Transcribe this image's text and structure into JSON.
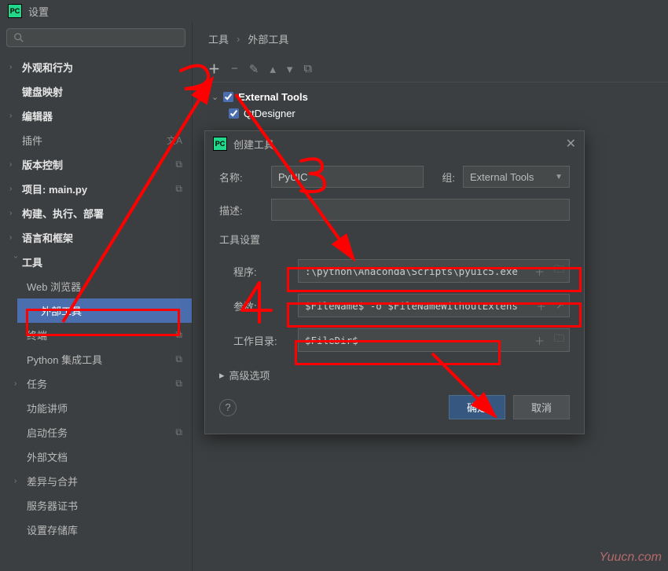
{
  "titlebar": {
    "title": "设置"
  },
  "sidebar": {
    "items": [
      {
        "label": "外观和行为",
        "bold": true,
        "arrow": true
      },
      {
        "label": "键盘映射",
        "bold": true,
        "arrow": false
      },
      {
        "label": "编辑器",
        "bold": true,
        "arrow": true
      },
      {
        "label": "插件",
        "bold": false,
        "arrow": false,
        "icon": "translate"
      },
      {
        "label": "版本控制",
        "bold": true,
        "arrow": true,
        "icon": "copy"
      },
      {
        "label": "项目: main.py",
        "bold": true,
        "arrow": true,
        "icon": "copy"
      },
      {
        "label": "构建、执行、部署",
        "bold": true,
        "arrow": true
      },
      {
        "label": "语言和框架",
        "bold": true,
        "arrow": true
      },
      {
        "label": "工具",
        "bold": true,
        "arrow": true,
        "expanded": true
      }
    ],
    "tools_children": [
      {
        "label": "Web 浏览器"
      },
      {
        "label": "外部工具",
        "selected": true
      },
      {
        "label": "终端",
        "icon": "copy"
      },
      {
        "label": "Python 集成工具",
        "icon": "copy"
      },
      {
        "label": "任务",
        "arrow": true,
        "icon": "copy"
      },
      {
        "label": "功能讲师"
      },
      {
        "label": "启动任务",
        "icon": "copy"
      },
      {
        "label": "外部文档"
      },
      {
        "label": "差异与合并",
        "arrow": true
      },
      {
        "label": "服务器证书"
      },
      {
        "label": "设置存储库"
      }
    ]
  },
  "breadcrumb": {
    "parent": "工具",
    "current": "外部工具"
  },
  "tool_list": {
    "group": "External Tools",
    "child": "QtDesigner"
  },
  "dialog": {
    "title": "创建工具",
    "labels": {
      "name": "名称:",
      "group": "组:",
      "desc": "描述:",
      "section": "工具设置",
      "program": "程序:",
      "args": "参数:",
      "workdir": "工作目录:",
      "advanced": "高级选项",
      "ok": "确定",
      "cancel": "取消"
    },
    "values": {
      "name": "PyUIC",
      "group": "External Tools",
      "desc": "",
      "program": ":\\python\\Anaconda\\Scripts\\pyuic5.exe",
      "args": "$FileName$ -o $FileNameWithoutExtens",
      "workdir": "$FileDir$"
    }
  },
  "watermark": "Yuucn.com"
}
